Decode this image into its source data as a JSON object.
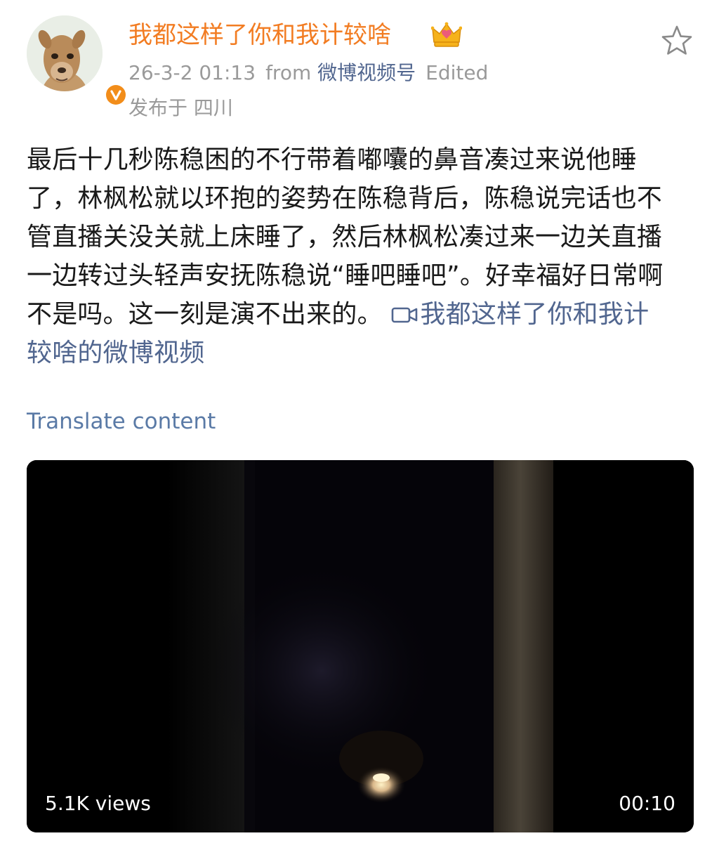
{
  "user": {
    "name": "我都这样了你和我计较啥"
  },
  "meta": {
    "date": "26-3-2 01:13",
    "from_label": "from",
    "source": "微博视频号",
    "edited": "Edited",
    "location": "发布于 四川"
  },
  "post": {
    "text": "最后十几秒陈稳困的不行带着嘟囔的鼻音凑过来说他睡了，林枫松就以环抱的姿势在陈稳背后，陈稳说完话也不管直播关没关就上床睡了，然后林枫松凑过来一边关直播一边转过头轻声安抚陈稳说“睡吧睡吧”。好幸福好日常啊不是吗。这一刻是演不出来的。",
    "video_link": "我都这样了你和我计较啥的微博视频"
  },
  "translate_label": "Translate content",
  "video": {
    "views": "5.1K views",
    "duration": "00:10"
  },
  "icons": {
    "crown": "crown-icon",
    "star": "star-icon",
    "verified": "verified-badge-icon",
    "video_link": "video-camera-icon"
  },
  "colors": {
    "username": "#f27c22",
    "link": "#51668f",
    "meta": "#9a9a9a",
    "translate": "#5a7aa6",
    "verified": "#f28d1a"
  }
}
